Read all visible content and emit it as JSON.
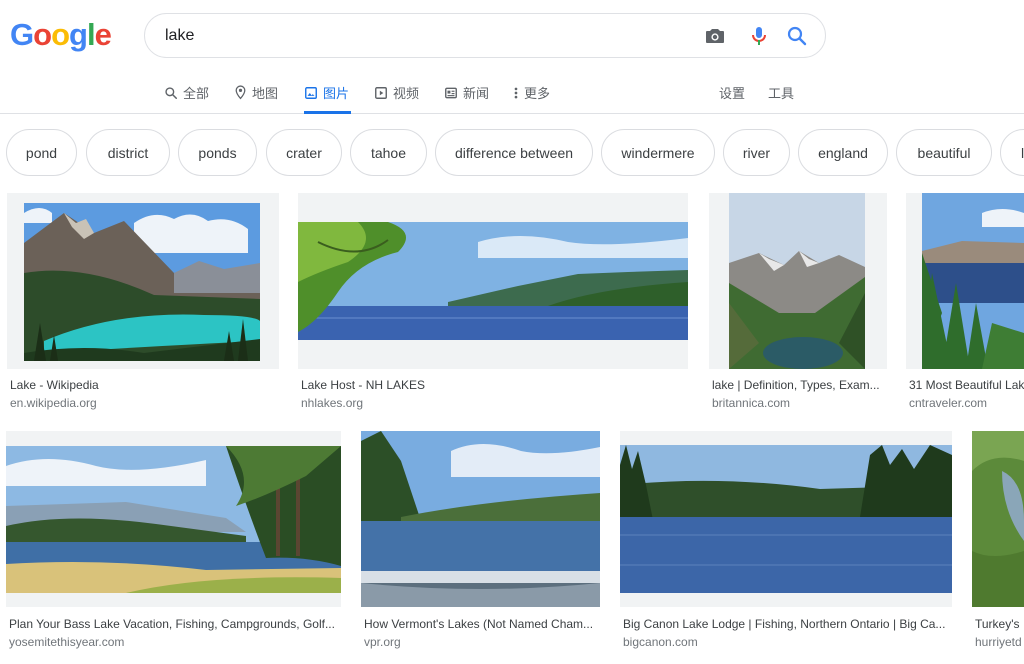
{
  "logo": {
    "letters": [
      "G",
      "o",
      "o",
      "g",
      "l",
      "e"
    ],
    "colors": [
      "#4285f4",
      "#ea4335",
      "#fbbc05",
      "#4285f4",
      "#34a853",
      "#ea4335"
    ]
  },
  "search": {
    "query": "lake"
  },
  "tabs": [
    {
      "label": "全部",
      "icon": "search-icon"
    },
    {
      "label": "地图",
      "icon": "map-pin-icon"
    },
    {
      "label": "图片",
      "icon": "image-icon",
      "active": true
    },
    {
      "label": "视频",
      "icon": "play-icon"
    },
    {
      "label": "新闻",
      "icon": "news-icon"
    },
    {
      "label": "更多",
      "icon": "more-vert-icon"
    }
  ],
  "tools": {
    "settings": "设置",
    "tools": "工具"
  },
  "chips": [
    "pond",
    "district",
    "ponds",
    "crater",
    "tahoe",
    "difference between",
    "windermere",
    "river",
    "england",
    "beautiful",
    "l"
  ],
  "results": [
    {
      "title": "Lake - Wikipedia",
      "source": "en.wikipedia.org"
    },
    {
      "title": "Lake Host - NH LAKES",
      "source": "nhlakes.org"
    },
    {
      "title": "lake | Definition, Types, Exam...",
      "source": "britannica.com"
    },
    {
      "title": "31 Most Beautiful Lak",
      "source": "cntraveler.com"
    },
    {
      "title": "Plan Your Bass Lake Vacation, Fishing, Campgrounds, Golf...",
      "source": "yosemitethisyear.com"
    },
    {
      "title": "How Vermont's Lakes (Not Named Cham...",
      "source": "vpr.org"
    },
    {
      "title": "Big Canon Lake Lodge | Fishing, Northern Ontario | Big Ca...",
      "source": "bigcanon.com"
    },
    {
      "title": "Turkey's",
      "source": "hurriyetd"
    }
  ],
  "colors": {
    "accent": "#1a73e8",
    "text": "#202124",
    "muted": "#5f6368"
  }
}
